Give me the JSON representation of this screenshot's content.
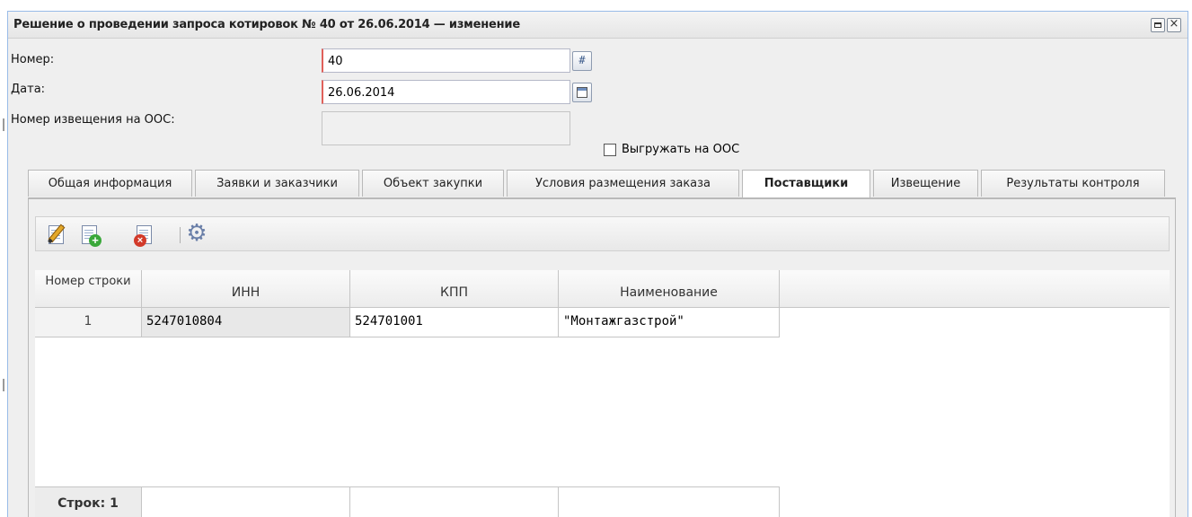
{
  "window": {
    "title": "Решение о проведении запроса котировок № 40 от 26.06.2014 — изменение",
    "maximize_glyph": "□",
    "close_glyph": "×"
  },
  "form": {
    "number_label": "Номер:",
    "number_value": "40",
    "number_trigger_glyph": "#",
    "date_label": "Дата:",
    "date_value": "26.06.2014",
    "oos_label": "Номер извещения на ООС:",
    "oos_value": "",
    "export_checkbox_label": "Выгружать на ООС",
    "export_checked": false
  },
  "tabs": [
    {
      "label": "Общая информация"
    },
    {
      "label": "Заявки и заказчики"
    },
    {
      "label": "Объект закупки"
    },
    {
      "label": "Условия размещения заказа"
    },
    {
      "label": "Поставщики",
      "active": true
    },
    {
      "label": "Извещение"
    },
    {
      "label": "Результаты контроля"
    }
  ],
  "toolbar": {
    "edit_icon": "edit-icon",
    "add_icon": "add-document-icon",
    "delete_icon": "delete-document-icon",
    "settings_icon": "gear-icon",
    "plus_glyph": "+",
    "x_glyph": "×",
    "gear_glyph": "⚙"
  },
  "grid": {
    "columns": [
      "Номер строки",
      "ИНН",
      "КПП",
      "Наименование"
    ],
    "rows": [
      {
        "row_number": "1",
        "inn": "5247010804",
        "kpp": "524701001",
        "name": "\"Монтажгазстрой\""
      }
    ],
    "footer": "Строк: 1"
  },
  "colors": {
    "window_border": "#99bbe8",
    "required_marker": "#e0605a"
  }
}
